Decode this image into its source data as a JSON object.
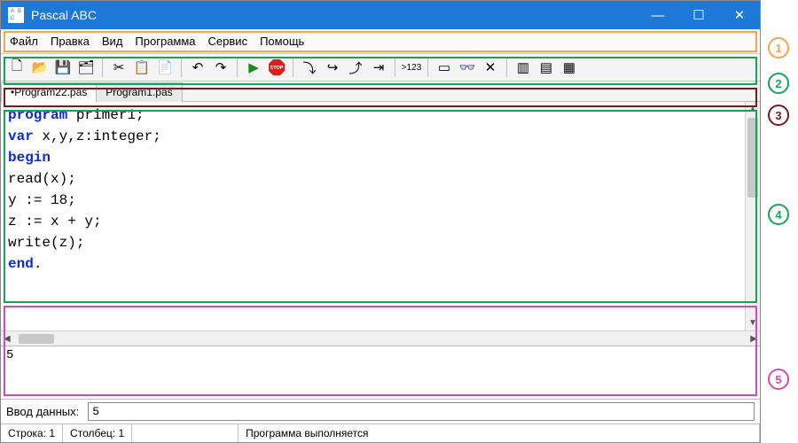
{
  "window": {
    "title": "Pascal ABC"
  },
  "menu": {
    "items": [
      "Файл",
      "Правка",
      "Вид",
      "Программа",
      "Сервис",
      "Помощь"
    ]
  },
  "toolbar": {
    "buttons": [
      {
        "name": "new-file-icon",
        "glyph": "🗋"
      },
      {
        "name": "open-file-icon",
        "glyph": "📂"
      },
      {
        "name": "save-icon",
        "glyph": "💾"
      },
      {
        "name": "save-all-icon",
        "glyph": "🗂"
      },
      {
        "sep": true
      },
      {
        "name": "cut-icon",
        "glyph": "✂"
      },
      {
        "name": "copy-icon",
        "glyph": "📋"
      },
      {
        "name": "paste-icon",
        "glyph": "📄"
      },
      {
        "sep": true
      },
      {
        "name": "undo-icon",
        "glyph": "↶"
      },
      {
        "name": "redo-icon",
        "glyph": "↷"
      },
      {
        "sep": true
      },
      {
        "name": "run-icon",
        "glyph": "▶"
      },
      {
        "name": "stop-icon",
        "glyph": "STOP"
      },
      {
        "sep": true
      },
      {
        "name": "step-into-icon",
        "glyph": "⤵"
      },
      {
        "name": "step-over-icon",
        "glyph": "↪"
      },
      {
        "name": "step-out-icon",
        "glyph": "⤴"
      },
      {
        "name": "run-to-cursor-icon",
        "glyph": "⇥"
      },
      {
        "sep": true
      },
      {
        "name": "watch-icon",
        "glyph": ">123"
      },
      {
        "sep": true
      },
      {
        "name": "window-icon",
        "glyph": "▭"
      },
      {
        "name": "glasses-icon",
        "glyph": "👓"
      },
      {
        "name": "close-view-icon",
        "glyph": "✕"
      },
      {
        "sep": true
      },
      {
        "name": "panel-1-icon",
        "glyph": "▥"
      },
      {
        "name": "panel-2-icon",
        "glyph": "▤"
      },
      {
        "name": "panel-3-icon",
        "glyph": "▦"
      }
    ]
  },
  "tabs": {
    "items": [
      {
        "label": "•Program22.pas",
        "active": true
      },
      {
        "label": "Program1.pas",
        "active": false
      }
    ]
  },
  "code": {
    "lines": [
      {
        "tokens": [
          {
            "t": "program",
            "kw": true
          },
          {
            "t": " primer1;"
          }
        ]
      },
      {
        "tokens": [
          {
            "t": "var",
            "kw": true
          },
          {
            "t": " x,y,z:integer;"
          }
        ]
      },
      {
        "tokens": [
          {
            "t": "begin",
            "kw": true
          }
        ]
      },
      {
        "tokens": [
          {
            "t": "read(x);"
          }
        ]
      },
      {
        "tokens": [
          {
            "t": "y := 18;"
          }
        ]
      },
      {
        "tokens": [
          {
            "t": "z := x + y;"
          }
        ]
      },
      {
        "tokens": [
          {
            "t": "write(z);"
          }
        ]
      },
      {
        "tokens": [
          {
            "t": "end",
            "kw": true
          },
          {
            "t": "."
          }
        ]
      }
    ]
  },
  "output": {
    "text": "5"
  },
  "inputrow": {
    "label": "Ввод данных:",
    "value": "5"
  },
  "status": {
    "line_label": "Строка: 1",
    "col_label": "Столбец: 1",
    "msg": "Программа выполняется"
  },
  "callouts": {
    "1": "1",
    "2": "2",
    "3": "3",
    "4": "4",
    "5": "5"
  }
}
